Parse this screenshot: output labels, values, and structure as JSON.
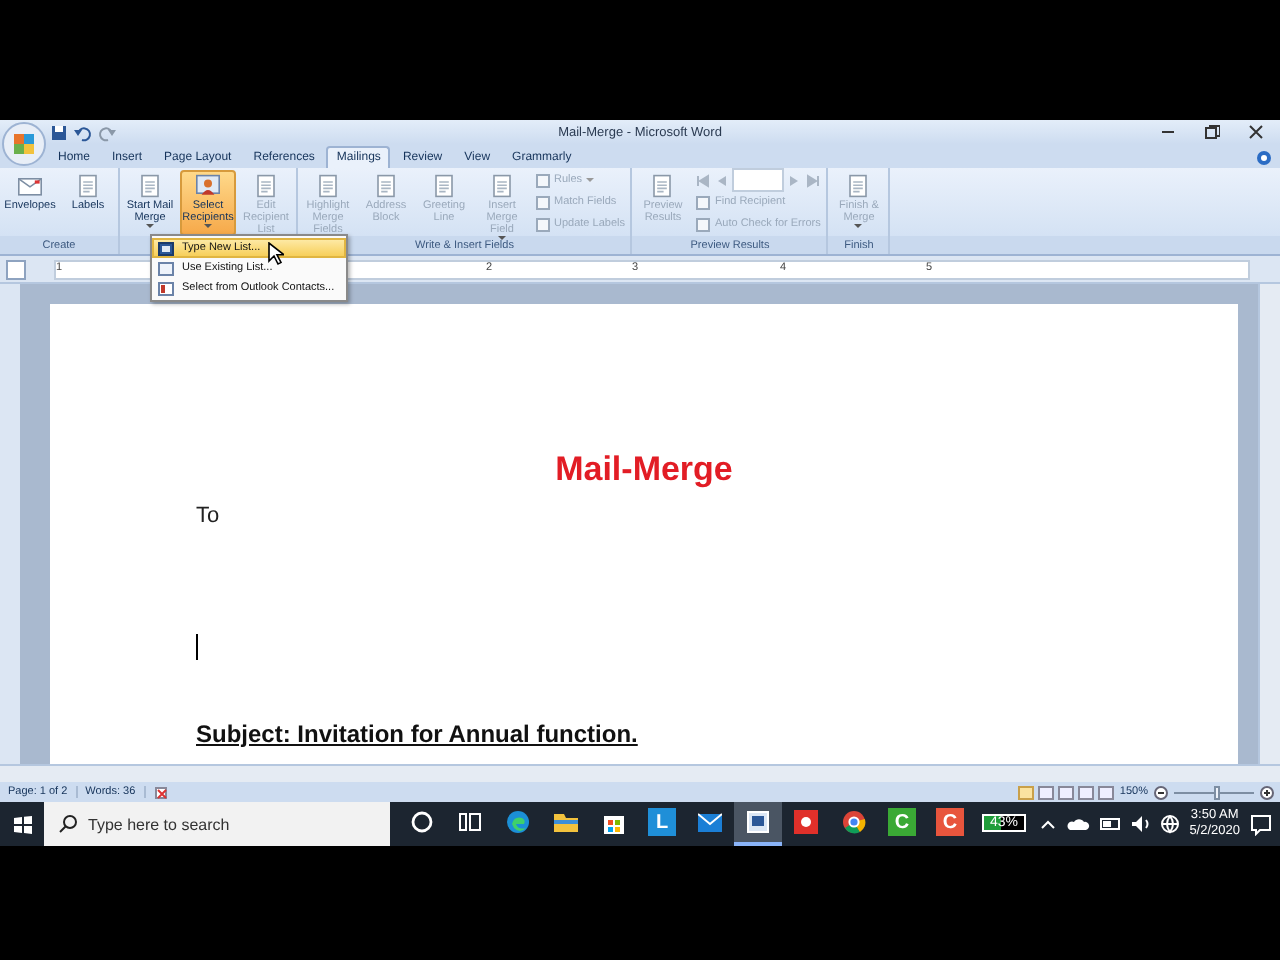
{
  "window": {
    "title": "Mail-Merge - Microsoft Word"
  },
  "tabs": [
    {
      "label": "Home",
      "selected": false
    },
    {
      "label": "Insert",
      "selected": false
    },
    {
      "label": "Page Layout",
      "selected": false
    },
    {
      "label": "References",
      "selected": false
    },
    {
      "label": "Mailings",
      "selected": true
    },
    {
      "label": "Review",
      "selected": false
    },
    {
      "label": "View",
      "selected": false
    },
    {
      "label": "Grammarly",
      "selected": false
    }
  ],
  "ribbon": {
    "groups": [
      {
        "label": "Create",
        "buttons": [
          {
            "kind": "large",
            "label": "Envelopes",
            "disabled": false,
            "pressed": false,
            "menu": false
          },
          {
            "kind": "large",
            "label": "Labels",
            "disabled": false,
            "pressed": false,
            "menu": false
          }
        ]
      },
      {
        "buttons": [
          {
            "kind": "large",
            "label": "Start Mail Merge",
            "disabled": false,
            "pressed": false,
            "menu": true
          },
          {
            "kind": "large",
            "label": "Select Recipients",
            "disabled": false,
            "pressed": true,
            "menu": true
          },
          {
            "kind": "large",
            "label": "Edit Recipient List",
            "disabled": true,
            "pressed": false,
            "menu": false
          }
        ]
      },
      {
        "label": "Write & Insert Fields",
        "buttons": [
          {
            "kind": "large",
            "label": "Highlight Merge Fields",
            "disabled": true,
            "pressed": false,
            "menu": false
          },
          {
            "kind": "large",
            "label": "Address Block",
            "disabled": true,
            "pressed": false,
            "menu": false
          },
          {
            "kind": "large",
            "label": "Greeting Line",
            "disabled": true,
            "pressed": false,
            "menu": false
          },
          {
            "kind": "large",
            "label": "Insert Merge Field",
            "disabled": true,
            "pressed": false,
            "menu": true
          },
          {
            "kind": "small",
            "label": "Rules",
            "disabled": true,
            "pressed": false,
            "menu": true
          },
          {
            "kind": "small",
            "label": "Match Fields",
            "disabled": true,
            "pressed": false,
            "menu": false
          },
          {
            "kind": "small",
            "label": "Update Labels",
            "disabled": true,
            "pressed": false,
            "menu": false
          }
        ]
      },
      {
        "label": "Preview Results",
        "buttons": [
          {
            "kind": "large",
            "label": "Preview Results",
            "disabled": true,
            "pressed": false,
            "menu": false
          },
          {
            "kind": "nav",
            "disabled": true
          },
          {
            "kind": "small",
            "label": "Find Recipient",
            "disabled": true,
            "pressed": false,
            "menu": false
          },
          {
            "kind": "small",
            "label": "Auto Check for Errors",
            "disabled": true,
            "pressed": false,
            "menu": false
          }
        ]
      },
      {
        "label": "Finish",
        "buttons": [
          {
            "kind": "large",
            "label": "Finish & Merge",
            "disabled": true,
            "pressed": false,
            "menu": true
          }
        ]
      }
    ]
  },
  "recipients_menu": [
    {
      "label": "Type New List...",
      "selected": true
    },
    {
      "label": "Use Existing List...",
      "selected": false
    },
    {
      "label": "Select from Outlook Contacts...",
      "selected": false
    }
  ],
  "ruler": [
    "1",
    "2",
    "3",
    "4",
    "5"
  ],
  "document": {
    "title": "Mail-Merge",
    "to": "To",
    "subject": "Subject: Invitation for Annual function."
  },
  "status_bar": {
    "page": "Page: 1 of 2",
    "words": "Words: 36",
    "zoom": {
      "reading": "150%",
      "level": 0.55
    }
  },
  "taskbar": {
    "search": {
      "placeholder": "Type here to search"
    },
    "apps": [
      {
        "kind": "cortana",
        "selected": false
      },
      {
        "kind": "task-view",
        "selected": false
      },
      {
        "kind": "edge",
        "selected": false
      },
      {
        "kind": "folder",
        "selected": false
      },
      {
        "kind": "store",
        "selected": false
      },
      {
        "kind": "tile",
        "label": "L",
        "color": "#1f8fd8",
        "selected": false
      },
      {
        "kind": "mail",
        "selected": false
      },
      {
        "kind": "word",
        "selected": true
      },
      {
        "kind": "record",
        "selected": false
      },
      {
        "kind": "chrome",
        "selected": false
      },
      {
        "kind": "tile",
        "label": "C",
        "color": "#3aa935",
        "selected": false
      },
      {
        "kind": "tile",
        "label": "C",
        "color": "#e8553d",
        "selected": false
      },
      {
        "kind": "battery",
        "label": "43%",
        "selected": false
      }
    ],
    "time": "3:50 AM",
    "date": "5/2/2020"
  }
}
